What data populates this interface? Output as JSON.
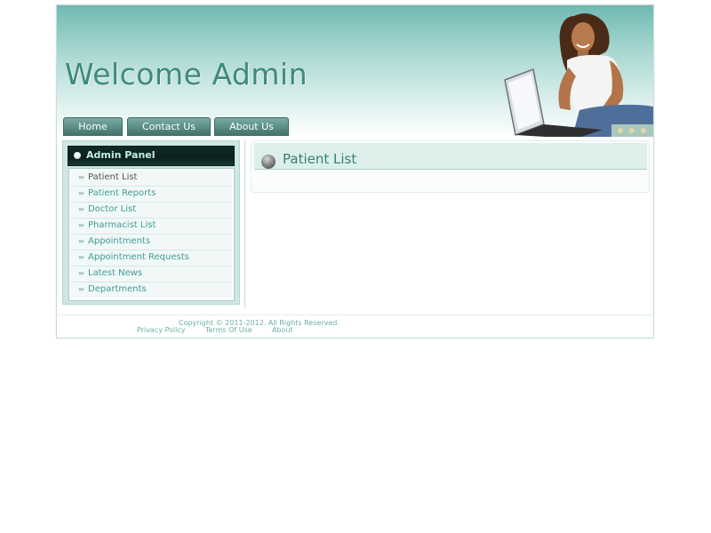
{
  "header": {
    "title": "Welcome Admin"
  },
  "nav": {
    "tabs": [
      {
        "label": "Home"
      },
      {
        "label": "Contact Us"
      },
      {
        "label": "About Us"
      }
    ]
  },
  "sidebar": {
    "title": "Admin Panel",
    "items": [
      {
        "label": "Patient List"
      },
      {
        "label": "Patient Reports"
      },
      {
        "label": "Doctor List"
      },
      {
        "label": "Pharmacist List"
      },
      {
        "label": "Appointments"
      },
      {
        "label": "Appointment Requests"
      },
      {
        "label": "Latest News"
      },
      {
        "label": "Departments"
      }
    ]
  },
  "main": {
    "title": "Patient List"
  },
  "footer": {
    "copyright": "Copyright © 2011-2012. All Rights Reserved.",
    "links": [
      {
        "label": "Privacy Policy"
      },
      {
        "label": "Terms Of Use"
      },
      {
        "label": "About"
      }
    ]
  },
  "colors": {
    "accent": "#3f8a80",
    "link": "#3f9d93",
    "header_top": "#6fbab2"
  }
}
